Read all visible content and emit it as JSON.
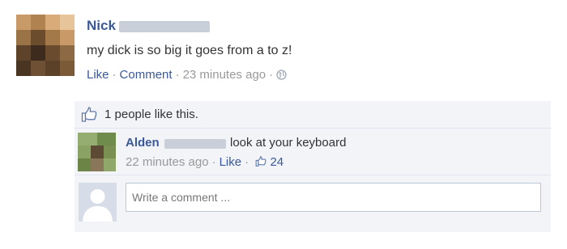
{
  "post": {
    "author": "Nick",
    "text": "my dick is so big it goes from a to z!",
    "actions": {
      "like": "Like",
      "comment": "Comment",
      "time": "23 minutes ago"
    }
  },
  "feedback": {
    "likes_text": "1 people like this.",
    "comment": {
      "author": "Alden",
      "text": "look at your keyboard",
      "time": "22 minutes ago",
      "like": "Like",
      "like_count": "24"
    },
    "write_placeholder": "Write a comment ..."
  },
  "colors": {
    "link": "#3b5998",
    "meta": "#999999",
    "feedback_bg": "#f2f4f8",
    "input_border": "#bdc7d8"
  },
  "icons": [
    "globe-icon",
    "thumbs-up-icon",
    "default-avatar-icon"
  ]
}
